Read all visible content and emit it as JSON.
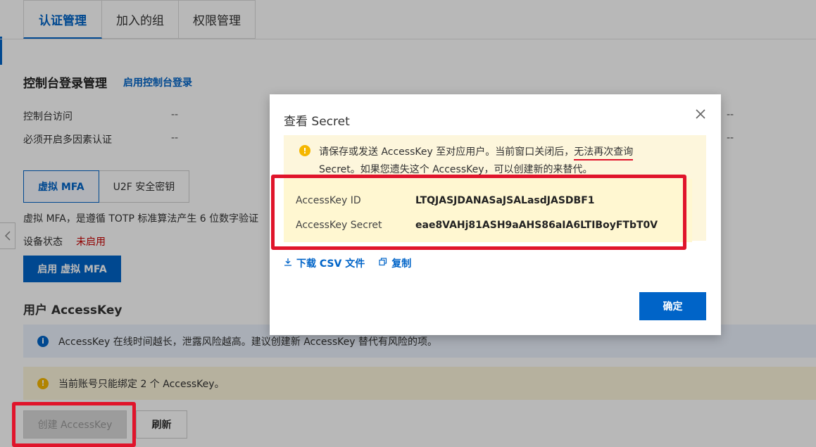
{
  "tabs": [
    {
      "label": "认证管理",
      "active": true
    },
    {
      "label": "加入的组",
      "active": false
    },
    {
      "label": "权限管理",
      "active": false
    }
  ],
  "console_login": {
    "title": "控制台登录管理",
    "enable_link": "启用控制台登录",
    "rows": [
      {
        "label": "控制台访问",
        "value": "--",
        "value_right": "--"
      },
      {
        "label": "必须开启多因素认证",
        "value": "--",
        "value_right": "--"
      }
    ]
  },
  "mfa": {
    "segments": [
      {
        "label": "虚拟 MFA",
        "active": true
      },
      {
        "label": "U2F 安全密钥",
        "active": false
      }
    ],
    "description": "虚拟 MFA，是遵循 TOTP 标准算法产生 6 位数字验证",
    "device_state_label": "设备状态",
    "device_state_value": "未启用",
    "enable_button": "启用 虚拟 MFA"
  },
  "accesskey": {
    "title": "用户 AccessKey",
    "info_text": "AccessKey 在线时间越长，泄露风险越高。建议创建新 AccessKey 替代有风险的项。",
    "warn_text": "当前账号只能绑定 2 个 AccessKey。",
    "create_button": "创建 AccessKey",
    "refresh_button": "刷新"
  },
  "modal": {
    "title": "查看 Secret",
    "alert_part1": "请保存或发送 AccessKey 至对应用户。当前窗口关闭后，",
    "alert_underlined": "无法再次查询",
    "alert_part2": "Secret。如果您遗失这个 AccessKey，可以创建新的来替代。",
    "fields": [
      {
        "label": "AccessKey ID",
        "value": "LTQJASJDANASaJSALasdJASDBF1"
      },
      {
        "label": "AccessKey Secret",
        "value": "eae8VAHj81ASH9aAHS86aIA6LTIBoyFTbT0V"
      }
    ],
    "download_link": "下载 CSV 文件",
    "copy_link": "复制",
    "ok_button": "确定"
  },
  "colors": {
    "primary": "#0064c8",
    "warning": "#f5b700",
    "danger": "#e0142b"
  }
}
